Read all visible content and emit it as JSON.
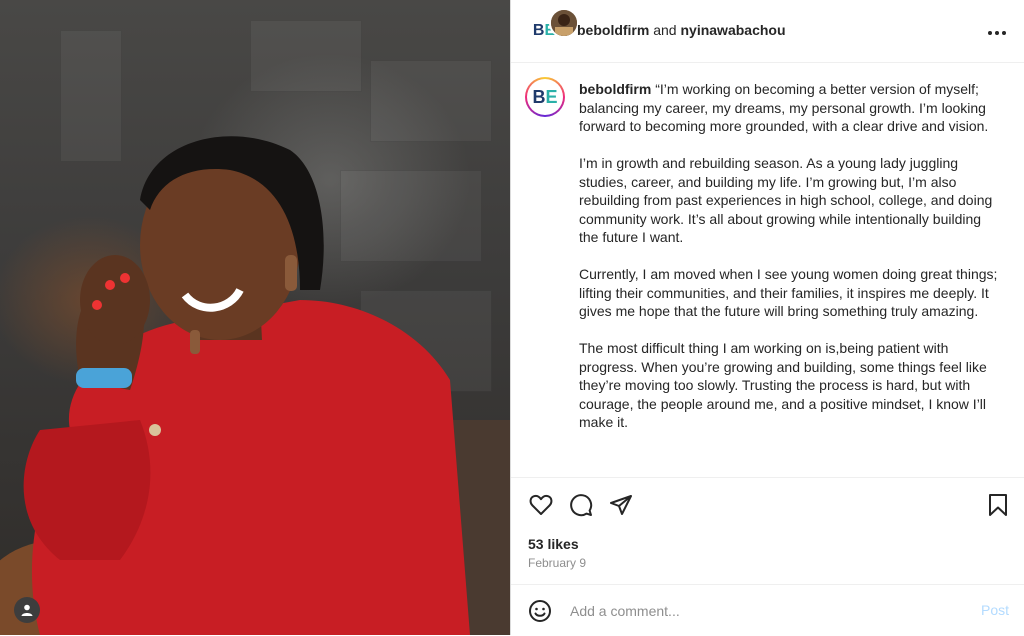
{
  "header": {
    "author": "beboldfirm",
    "joiner": "and",
    "collaborator": "nyinawabachou",
    "logo_text_b": "B",
    "logo_text_e": "E",
    "more_icon": "more-horizontal-icon"
  },
  "caption": {
    "username": "beboldfirm",
    "paragraphs": [
      "“I’m working on becoming a better version of myself; balancing my career, my dreams, my personal growth. I’m looking forward to becoming more grounded, with a clear drive and vision.",
      "I’m in growth and rebuilding season. As a young lady juggling studies, career, and building my life. I’m growing but, I’m also rebuilding from past experiences in high school, college, and doing community work. It’s all about growing while intentionally building the future I want.",
      "Currently, I am moved when I see young women doing great things; lifting their communities, and their families, it inspires me deeply. It gives me hope that the future will bring something truly amazing.",
      "The most difficult thing I am working on is,being patient with progress. When you’re growing and building, some things feel like they’re moving too slowly. Trusting the process is hard, but with courage, the people around me, and a positive mindset, I know I’ll make it."
    ]
  },
  "actions": {
    "icons": [
      "heart-icon",
      "comment-icon",
      "share-icon",
      "bookmark-icon"
    ],
    "likes": "53 likes",
    "date": "February 9"
  },
  "comment": {
    "placeholder": "Add a comment...",
    "post_label": "Post",
    "emoji_icon": "emoji-icon"
  },
  "colors": {
    "brand_blue": "#1f3a6b",
    "brand_teal": "#2ab0a8",
    "post_disabled": "#b3dbff",
    "muted": "#8e8e8e"
  }
}
